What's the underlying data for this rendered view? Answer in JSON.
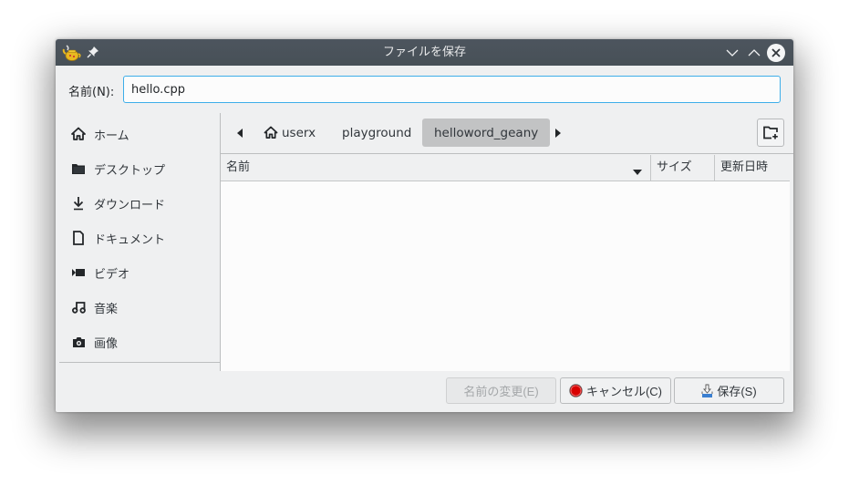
{
  "window": {
    "title": "ファイルを保存",
    "icons": {
      "app": "geany-teapot-icon",
      "pin": "pin-icon",
      "minimize": "chevron-down-icon",
      "maximize": "chevron-up-icon",
      "close": "close-icon"
    }
  },
  "name_field": {
    "label": "名前(N):",
    "value": "hello.cpp"
  },
  "sidebar": {
    "items": [
      {
        "label": "ホーム",
        "icon": "home-icon"
      },
      {
        "label": "デスクトップ",
        "icon": "folder-icon"
      },
      {
        "label": "ダウンロード",
        "icon": "download-icon"
      },
      {
        "label": "ドキュメント",
        "icon": "document-icon"
      },
      {
        "label": "ビデオ",
        "icon": "video-icon"
      },
      {
        "label": "音楽",
        "icon": "music-icon"
      },
      {
        "label": "画像",
        "icon": "camera-icon"
      }
    ]
  },
  "path_bar": {
    "crumbs": [
      {
        "label": "userx",
        "icon": "home-icon",
        "active": false
      },
      {
        "label": "playground",
        "active": false
      },
      {
        "label": "helloword_geany",
        "active": true
      }
    ]
  },
  "file_list": {
    "columns": [
      "名前",
      "サイズ",
      "更新日時"
    ],
    "sorted_column": "名前",
    "rows": []
  },
  "buttons": {
    "rename": "名前の変更(E)",
    "cancel": "キャンセル(C)",
    "save": "保存(S)"
  },
  "colors": {
    "accent": "#3daee9",
    "titlebar": "#475057",
    "cancel_icon": "#d90000",
    "save_icon": "#3b7fd0"
  }
}
